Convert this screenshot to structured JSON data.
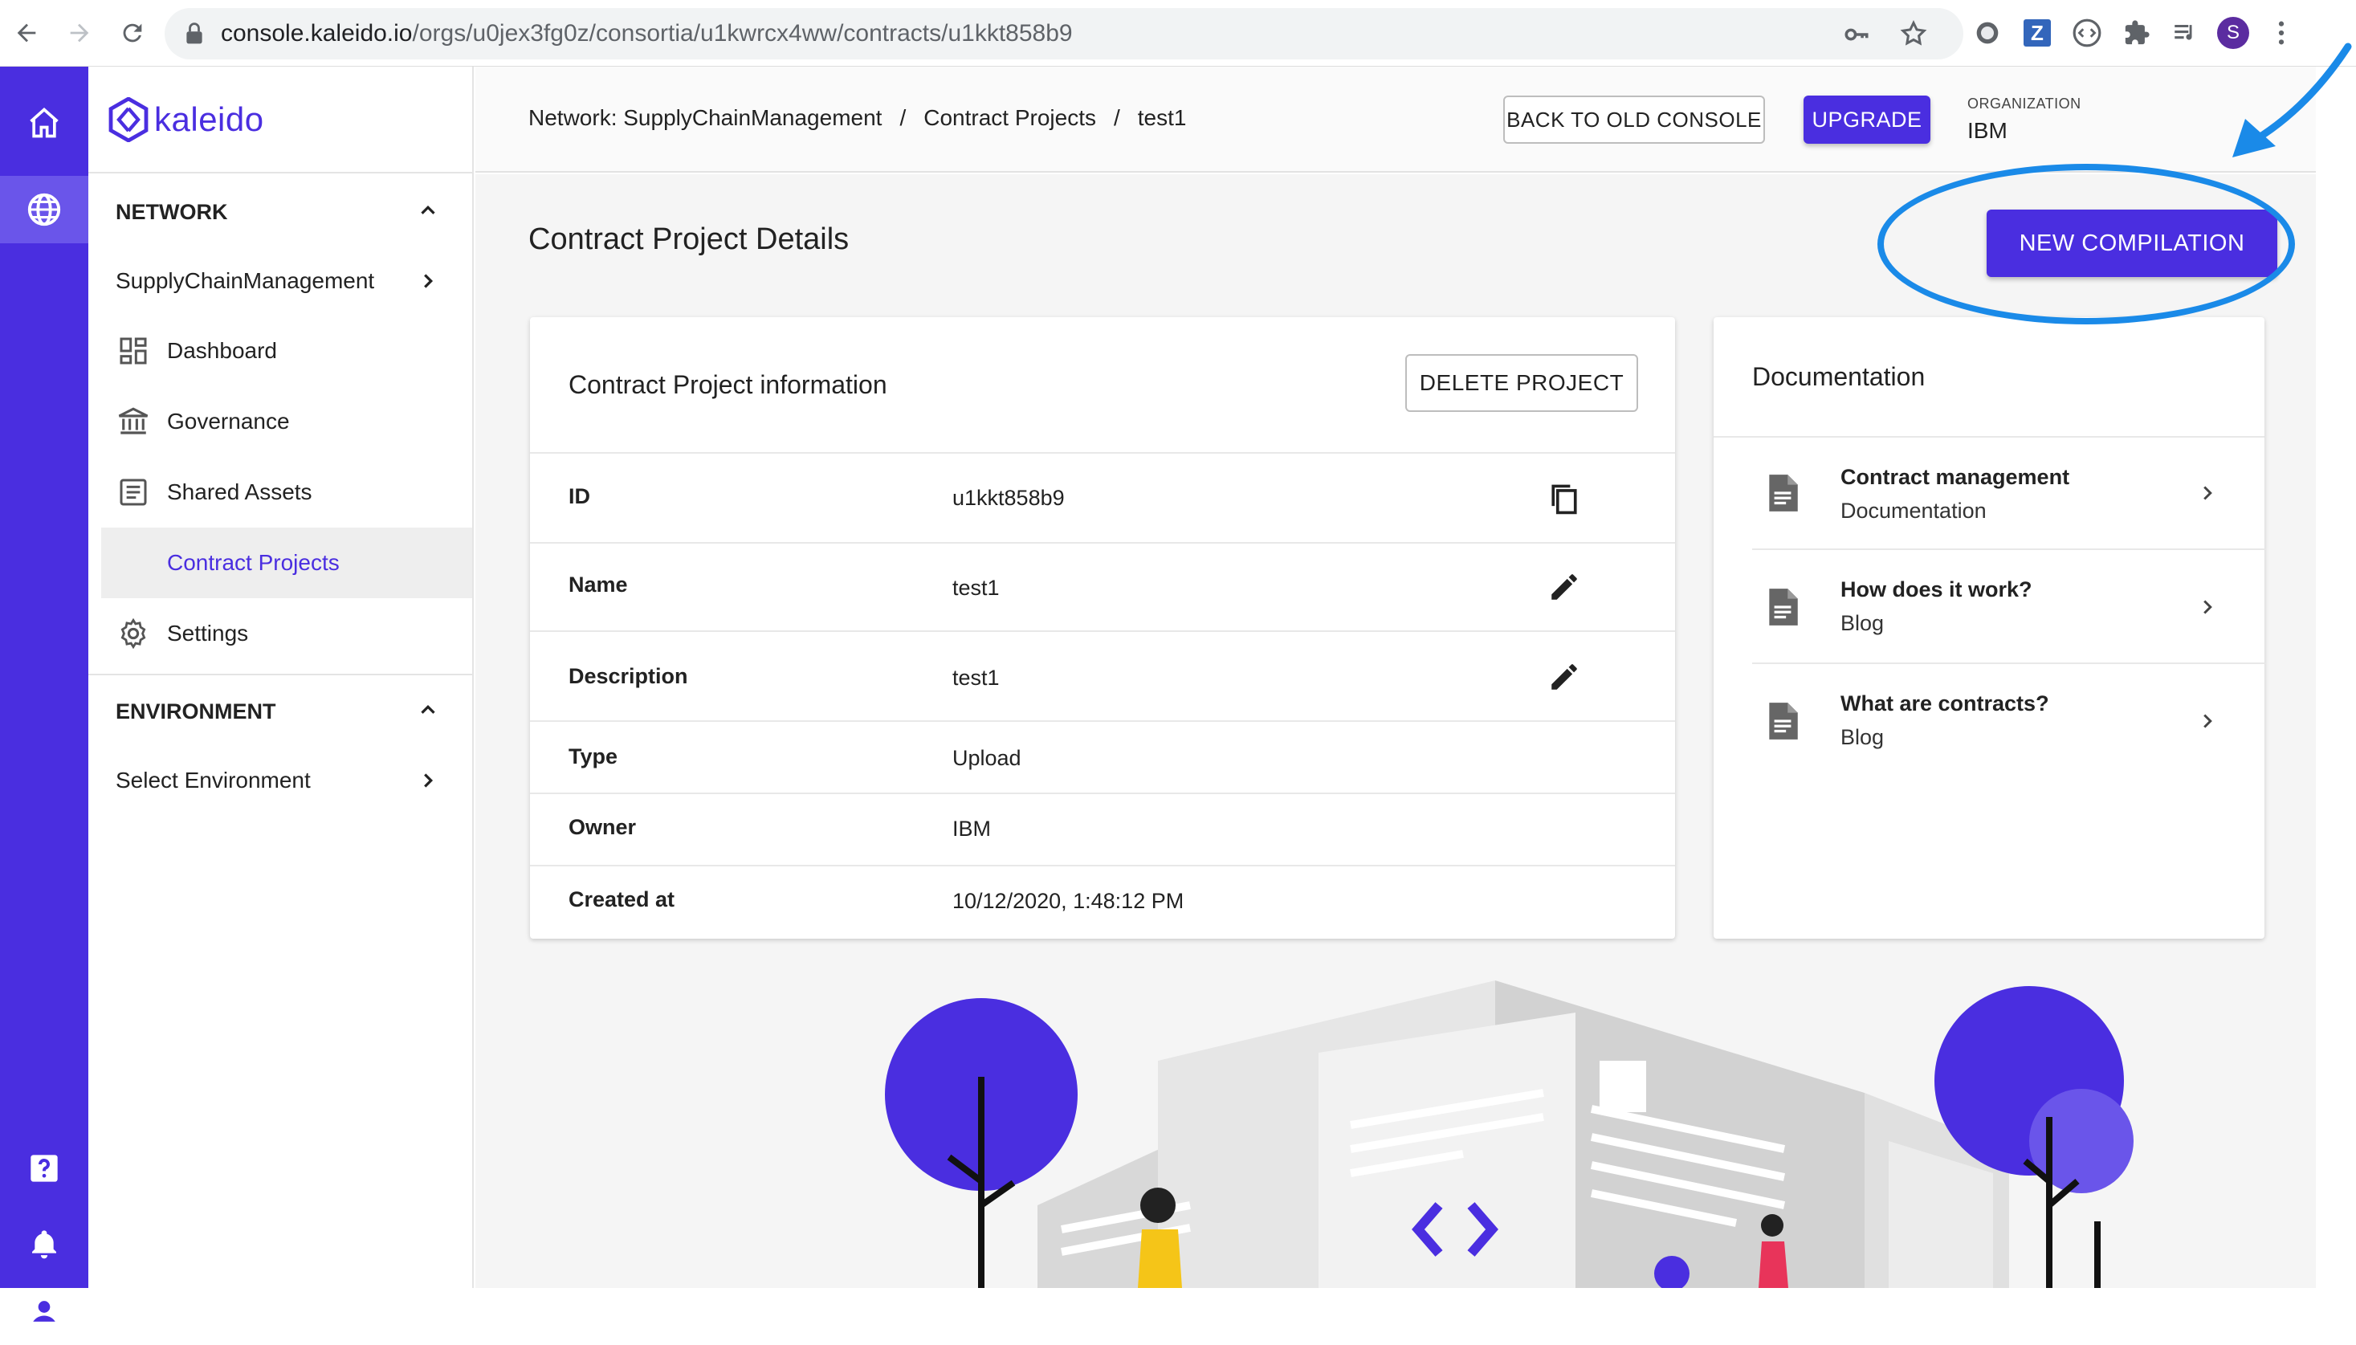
{
  "browser": {
    "url_host": "console.kaleido.io",
    "url_path": "/orgs/u0jex3fg0z/consortia/u1kwrcx4ww/contracts/u1kkt858b9",
    "profile_initial": "S",
    "ext_z_label": "Z"
  },
  "brand": {
    "name": "kaleido",
    "color": "#4a2ee0"
  },
  "sidebar": {
    "network_header": "NETWORK",
    "network_name": "SupplyChainManagement",
    "items": [
      {
        "label": "Dashboard",
        "icon": "dashboard-icon"
      },
      {
        "label": "Governance",
        "icon": "bank-icon"
      },
      {
        "label": "Shared Assets",
        "icon": "document-list-icon"
      },
      {
        "label": "Contract Projects",
        "icon": "",
        "active": true
      },
      {
        "label": "Settings",
        "icon": "gear-icon"
      }
    ],
    "environment_header": "ENVIRONMENT",
    "environment_select": "Select Environment"
  },
  "header": {
    "breadcrumb": [
      "Network: SupplyChainManagement",
      "/",
      "Contract Projects",
      "/",
      "test1"
    ],
    "back_button": "BACK TO OLD CONSOLE",
    "upgrade_button": "UPGRADE",
    "org_caption": "ORGANIZATION",
    "org_name": "IBM"
  },
  "page": {
    "title": "Contract Project Details",
    "new_compilation_button": "NEW COMPILATION"
  },
  "project_info": {
    "title": "Contract Project information",
    "delete_button": "DELETE PROJECT",
    "rows": [
      {
        "label": "ID",
        "value": "u1kkt858b9",
        "action": "copy-icon"
      },
      {
        "label": "Name",
        "value": "test1",
        "action": "edit-icon"
      },
      {
        "label": "Description",
        "value": "test1",
        "action": "edit-icon"
      },
      {
        "label": "Type",
        "value": "Upload"
      },
      {
        "label": "Owner",
        "value": "IBM"
      },
      {
        "label": "Created at",
        "value": "10/12/2020, 1:48:12 PM"
      }
    ]
  },
  "documentation": {
    "title": "Documentation",
    "items": [
      {
        "title": "Contract management",
        "subtitle": "Documentation"
      },
      {
        "title": "How does it work?",
        "subtitle": "Blog"
      },
      {
        "title": "What are contracts?",
        "subtitle": "Blog"
      }
    ]
  },
  "colors": {
    "accent": "#4a2ee0",
    "annotation": "#1a8ae8"
  }
}
